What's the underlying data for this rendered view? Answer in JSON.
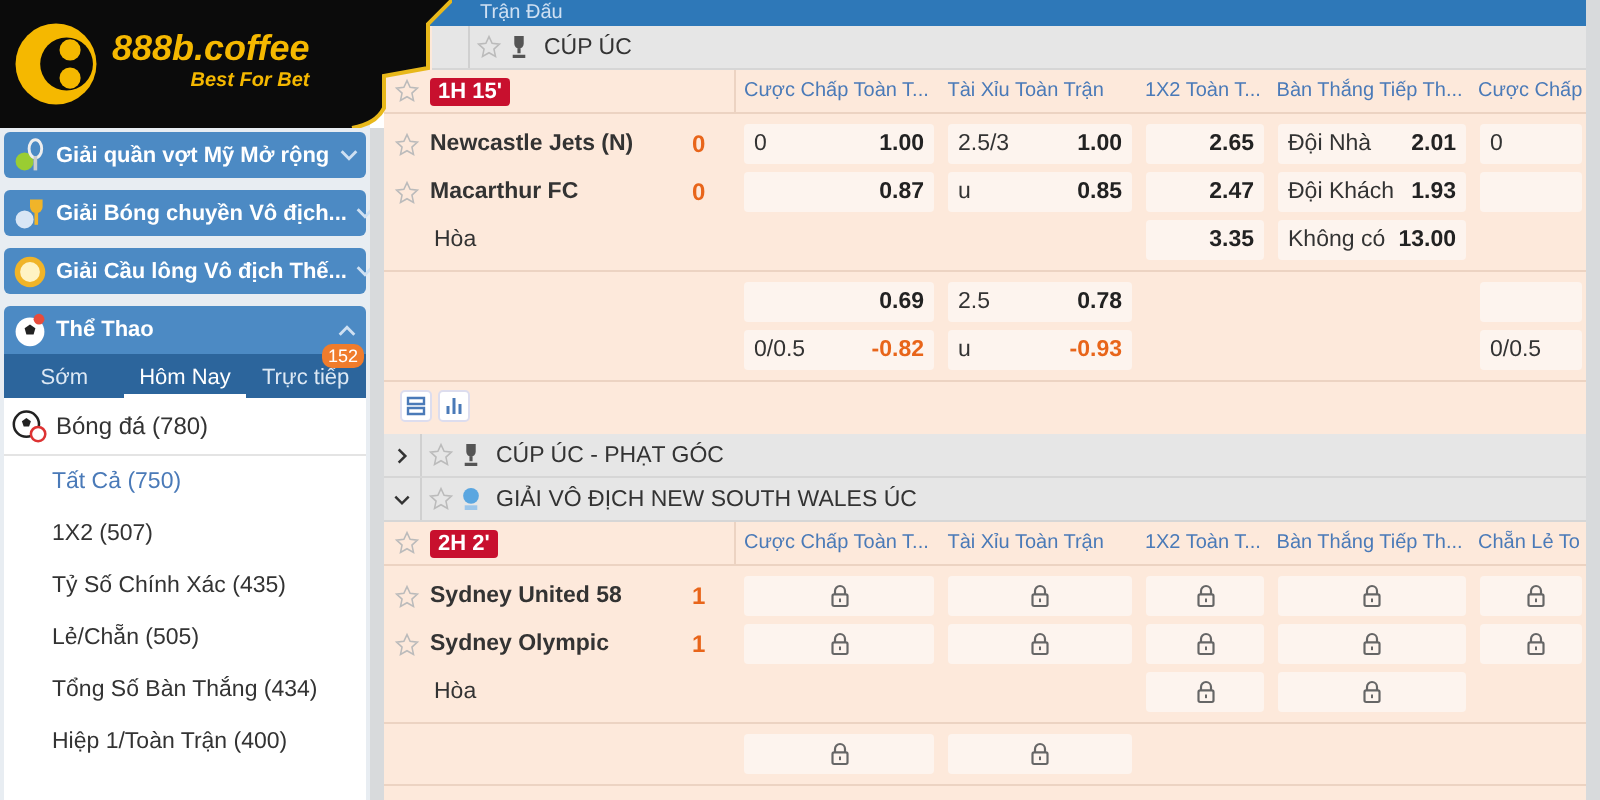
{
  "logo": {
    "name": "888b.coffee",
    "tagline": "Best For Bet"
  },
  "sidebar": {
    "panels": [
      {
        "label": "Giải quần vợt Mỹ Mở rộng",
        "kind": "tennis",
        "expanded": false
      },
      {
        "label": "Giải Bóng chuyền Vô địch...",
        "kind": "volleyball",
        "expanded": false
      },
      {
        "label": "Giải Cầu lông Vô địch Thế...",
        "kind": "badminton",
        "expanded": false
      },
      {
        "label": "Thể Thao",
        "kind": "sports",
        "expanded": true
      }
    ],
    "tabs": [
      {
        "label": "Sớm",
        "selected": false
      },
      {
        "label": "Hôm Nay",
        "selected": true
      },
      {
        "label": "Trực tiếp",
        "selected": false,
        "badge": "152"
      }
    ],
    "sport": {
      "label": "Bóng đá",
      "count": "(780)"
    },
    "markets": [
      {
        "label": "Tất Cả",
        "count": "(750)",
        "selected": true
      },
      {
        "label": "1X2",
        "count": "(507)",
        "selected": false
      },
      {
        "label": "Tỷ Số Chính Xác",
        "count": "(435)",
        "selected": false
      },
      {
        "label": "Lẻ/Chẵn",
        "count": "(505)",
        "selected": false
      },
      {
        "label": "Tổng Số Bàn Thắng",
        "count": "(434)",
        "selected": false
      },
      {
        "label": "Hiệp 1/Toàn Trận",
        "count": "(400)",
        "selected": false
      }
    ]
  },
  "main": {
    "title": "Trận Đấu",
    "leagues": [
      {
        "name": "CÚP ÚC",
        "kind": "trophy",
        "match": {
          "status": "1H 15'",
          "columns": [
            "Cược Chấp Toàn T...",
            "Tài Xỉu Toàn Trận",
            "1X2 Toàn T...",
            "Bàn Thắng Tiếp Th...",
            "Cược Chấp"
          ],
          "blocks": [
            {
              "rows": [
                {
                  "kind": "team",
                  "name": "Newcastle Jets (N)",
                  "score": "0",
                  "cells": [
                    {
                      "kind": "odds",
                      "line": "0",
                      "price": "1.00",
                      "negative": false
                    },
                    {
                      "kind": "odds",
                      "line": "2.5/3",
                      "price": "1.00",
                      "negative": false
                    },
                    {
                      "kind": "odds",
                      "price": "2.65",
                      "negative": false
                    },
                    {
                      "kind": "odds",
                      "line": "Đội Nhà",
                      "price": "2.01",
                      "negative": false
                    },
                    {
                      "kind": "odds",
                      "line": "0"
                    }
                  ]
                },
                {
                  "kind": "team",
                  "name": "Macarthur FC",
                  "score": "0",
                  "cells": [
                    {
                      "kind": "odds",
                      "price": "0.87",
                      "negative": false
                    },
                    {
                      "kind": "odds",
                      "line": "u",
                      "price": "0.85",
                      "negative": false
                    },
                    {
                      "kind": "odds",
                      "price": "2.47",
                      "negative": false
                    },
                    {
                      "kind": "odds",
                      "line": "Đội Khách",
                      "price": "1.93",
                      "negative": false
                    },
                    {
                      "kind": "blank"
                    }
                  ]
                },
                {
                  "kind": "draw",
                  "name": "Hòa",
                  "cells": [
                    {
                      "kind": "none"
                    },
                    {
                      "kind": "none"
                    },
                    {
                      "kind": "odds",
                      "price": "3.35",
                      "negative": false
                    },
                    {
                      "kind": "odds",
                      "line": "Không có",
                      "price": "13.00",
                      "negative": false
                    },
                    {
                      "kind": "none"
                    }
                  ]
                }
              ]
            },
            {
              "rows": [
                {
                  "kind": "extra",
                  "cells": [
                    {
                      "kind": "odds",
                      "price": "0.69",
                      "negative": false
                    },
                    {
                      "kind": "odds",
                      "line": "2.5",
                      "price": "0.78",
                      "negative": false
                    },
                    {
                      "kind": "none"
                    },
                    {
                      "kind": "none"
                    },
                    {
                      "kind": "blank"
                    }
                  ]
                },
                {
                  "kind": "extra",
                  "cells": [
                    {
                      "kind": "odds",
                      "line": "0/0.5",
                      "price": "-0.82",
                      "negative": true
                    },
                    {
                      "kind": "odds",
                      "line": "u",
                      "price": "-0.93",
                      "negative": true
                    },
                    {
                      "kind": "none"
                    },
                    {
                      "kind": "none"
                    },
                    {
                      "kind": "odds",
                      "line": "0/0.5"
                    }
                  ]
                }
              ]
            }
          ],
          "tools": true
        }
      },
      {
        "name": "CÚP ÚC - PHẠT GÓC",
        "kind": "trophy",
        "expanded": false
      },
      {
        "name": "GIẢI VÔ ĐỊCH NEW SOUTH WALES ÚC",
        "kind": "globe",
        "expanded": true,
        "match": {
          "status": "2H 2'",
          "columns": [
            "Cược Chấp Toàn T...",
            "Tài Xỉu Toàn Trận",
            "1X2 Toàn T...",
            "Bàn Thắng Tiếp Th...",
            "Chẵn Lẻ To"
          ],
          "blocks": [
            {
              "rows": [
                {
                  "kind": "team",
                  "name": "Sydney United 58",
                  "score": "1",
                  "cells": [
                    {
                      "kind": "locked"
                    },
                    {
                      "kind": "locked"
                    },
                    {
                      "kind": "locked"
                    },
                    {
                      "kind": "locked"
                    },
                    {
                      "kind": "locked"
                    }
                  ]
                },
                {
                  "kind": "team",
                  "name": "Sydney Olympic",
                  "score": "1",
                  "cells": [
                    {
                      "kind": "locked"
                    },
                    {
                      "kind": "locked"
                    },
                    {
                      "kind": "locked"
                    },
                    {
                      "kind": "locked"
                    },
                    {
                      "kind": "locked"
                    }
                  ]
                },
                {
                  "kind": "draw",
                  "name": "Hòa",
                  "cells": [
                    {
                      "kind": "none"
                    },
                    {
                      "kind": "none"
                    },
                    {
                      "kind": "locked"
                    },
                    {
                      "kind": "locked"
                    },
                    {
                      "kind": "none"
                    }
                  ]
                }
              ]
            },
            {
              "rows": [
                {
                  "kind": "extra",
                  "cells": [
                    {
                      "kind": "locked"
                    },
                    {
                      "kind": "locked"
                    },
                    {
                      "kind": "none"
                    },
                    {
                      "kind": "none"
                    },
                    {
                      "kind": "none"
                    }
                  ]
                }
              ]
            }
          ]
        }
      }
    ]
  }
}
